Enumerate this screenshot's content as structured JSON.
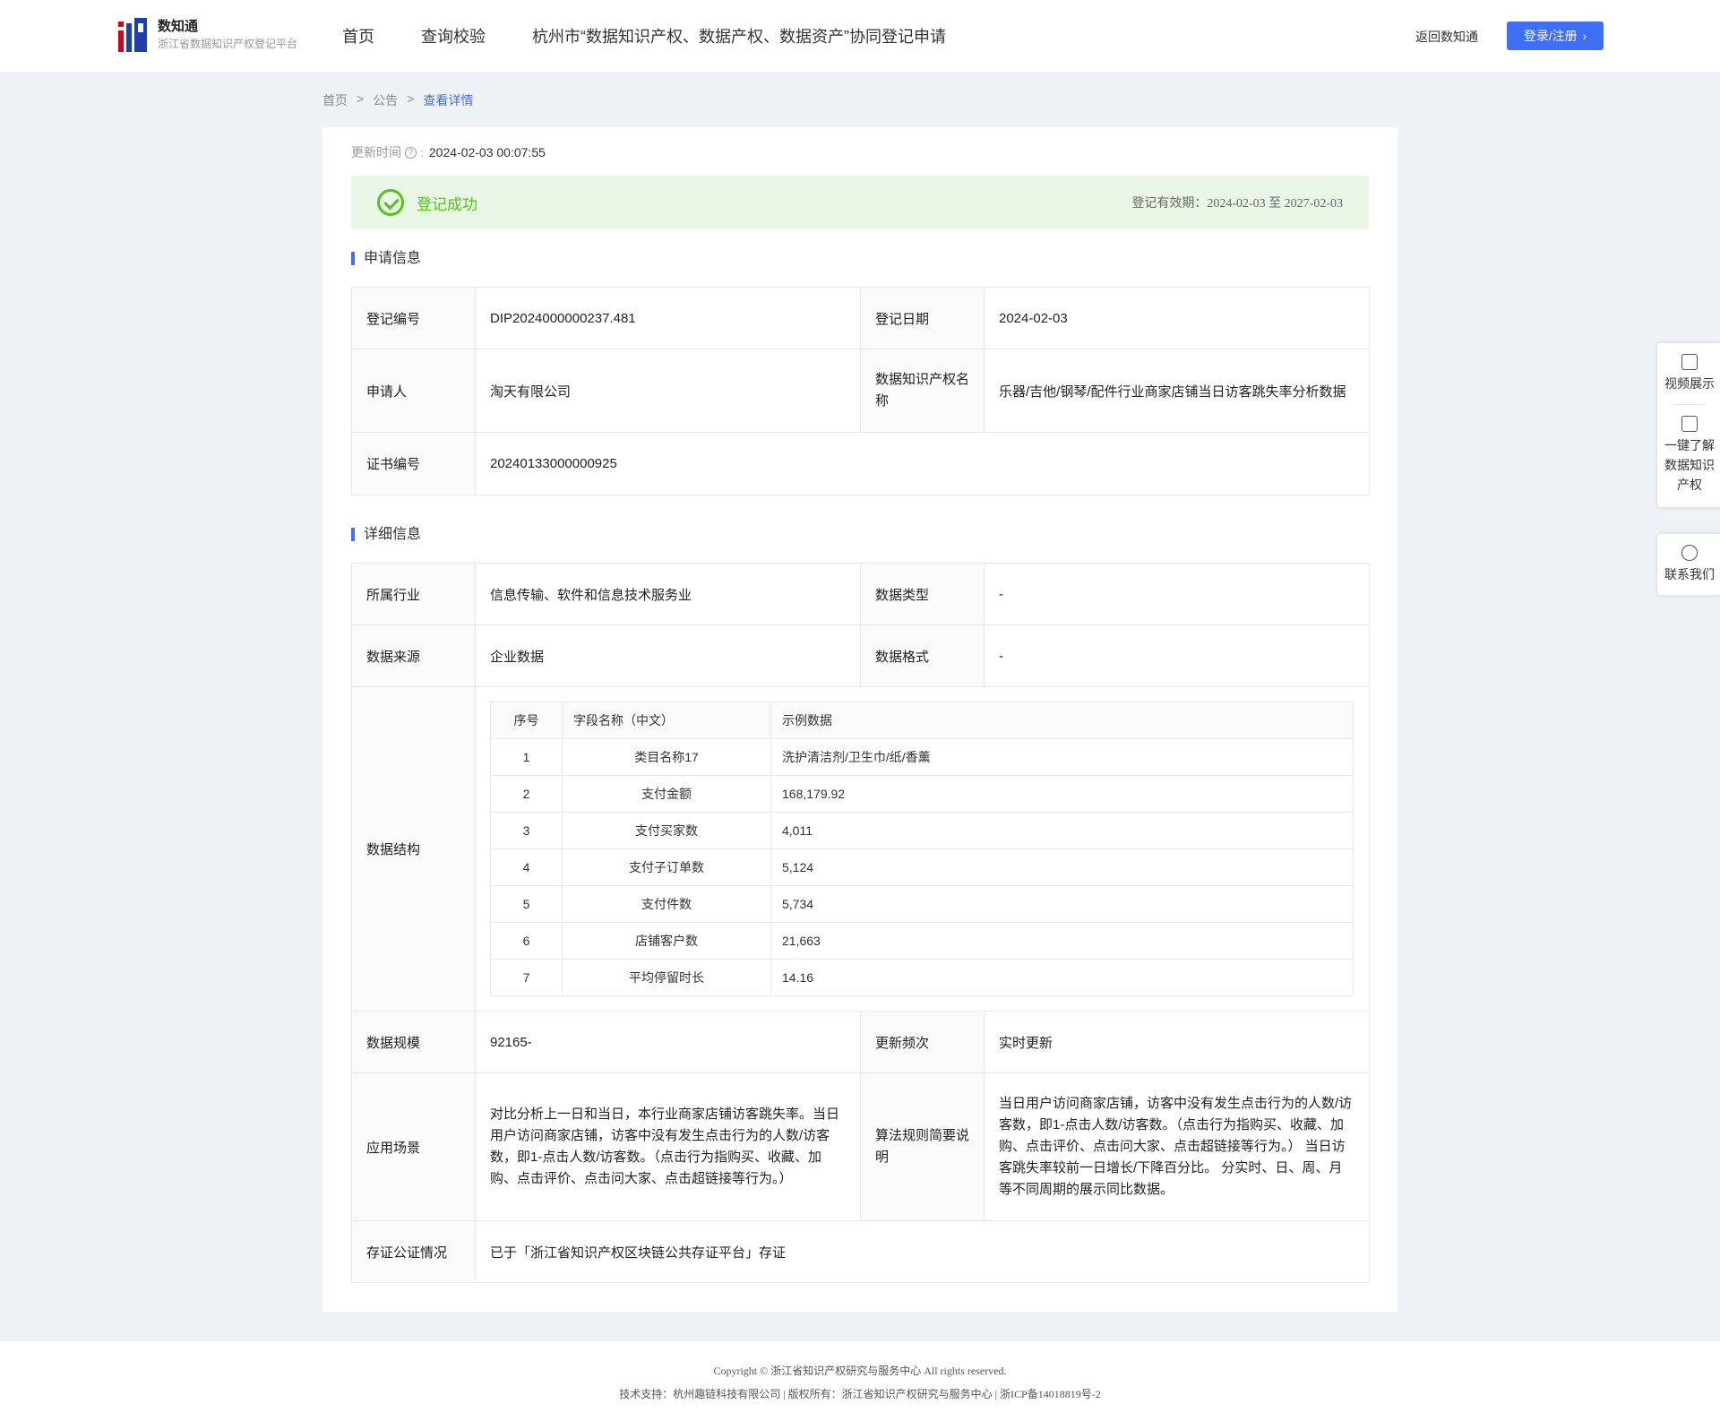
{
  "header": {
    "logo_title": "数知通",
    "logo_subtitle": "浙江省数据知识产权登记平台",
    "nav": [
      "首页",
      "查询校验",
      "杭州市“数据知识产权、数据产权、数据资产”协同登记申请"
    ],
    "back_label": "返回数知通",
    "login_label": "登录/注册"
  },
  "breadcrumb": {
    "home": "首页",
    "sep": ">",
    "notice": "公告",
    "current": "查看详情"
  },
  "update": {
    "label": "更新时间",
    "value": "2024-02-03 00:07:55"
  },
  "status": {
    "text": "登记成功",
    "validity": "登记有效期：2024-02-03 至 2027-02-03"
  },
  "apply_info": {
    "title": "申请信息",
    "reg_no_label": "登记编号",
    "reg_no": "DIP2024000000237.481",
    "reg_date_label": "登记日期",
    "reg_date": "2024-02-03",
    "applicant_label": "申请人",
    "applicant": "淘天有限公司",
    "ip_name_label": "数据知识产权名称",
    "ip_name": "乐器/吉他/钢琴/配件行业商家店铺当日访客跳失率分析数据",
    "cert_no_label": "证书编号",
    "cert_no": "20240133000000925"
  },
  "detail_info": {
    "title": "详细信息",
    "industry_label": "所属行业",
    "industry": "信息传输、软件和信息技术服务业",
    "data_type_label": "数据类型",
    "data_type": "-",
    "source_label": "数据来源",
    "source": "企业数据",
    "format_label": "数据格式",
    "format": "-",
    "structure_label": "数据结构",
    "structure_headers": [
      "序号",
      "字段名称（中文）",
      "示例数据"
    ],
    "structure_rows": [
      [
        "1",
        "类目名称17",
        "洗护清洁剂/卫生巾/纸/香薰"
      ],
      [
        "2",
        "支付金额",
        "168,179.92"
      ],
      [
        "3",
        "支付买家数",
        "4,011"
      ],
      [
        "4",
        "支付子订单数",
        "5,124"
      ],
      [
        "5",
        "支付件数",
        "5,734"
      ],
      [
        "6",
        "店铺客户数",
        "21,663"
      ],
      [
        "7",
        "平均停留时长",
        "14.16"
      ]
    ],
    "scale_label": "数据规模",
    "scale": "92165-",
    "freq_label": "更新频次",
    "freq": "实时更新",
    "scenario_label": "应用场景",
    "scenario": "对比分析上一日和当日，本行业商家店铺访客跳失率。当日用户访问商家店铺，访客中没有发生点击行为的人数/访客数，即1-点击人数/访客数。（点击行为指购买、收藏、加购、点击评价、点击问大家、点击超链接等行为。）",
    "algo_label": "算法规则简要说明",
    "algo": "当日用户访问商家店铺，访客中没有发生点击行为的人数/访客数，即1-点击人数/访客数。（点击行为指购买、收藏、加购、点击评价、点击问大家、点击超链接等行为。） 当日访客跳失率较前一日增长/下降百分比。 分实时、日、周、月等不同周期的展示同比数据。",
    "evidence_label": "存证公证情况",
    "evidence": "已于「浙江省知识产权区块链公共存证平台」存证"
  },
  "side_tools": {
    "video": "视频展示",
    "learn": "一键了解数据知识产权",
    "contact": "联系我们"
  },
  "footer": {
    "line1": "Copyright © 浙江省知识产权研究与服务中心 All rights reserved.",
    "line2": "技术支持：杭州趣链科技有限公司 | 版权所有：浙江省知识产权研究与服务中心 | 浙ICP备14018819号-2"
  },
  "colors": {
    "accent": "#3e6ff5",
    "success": "#52c41a",
    "success_bg": "#ebf7e6",
    "page_bg": "#eef2f6"
  }
}
